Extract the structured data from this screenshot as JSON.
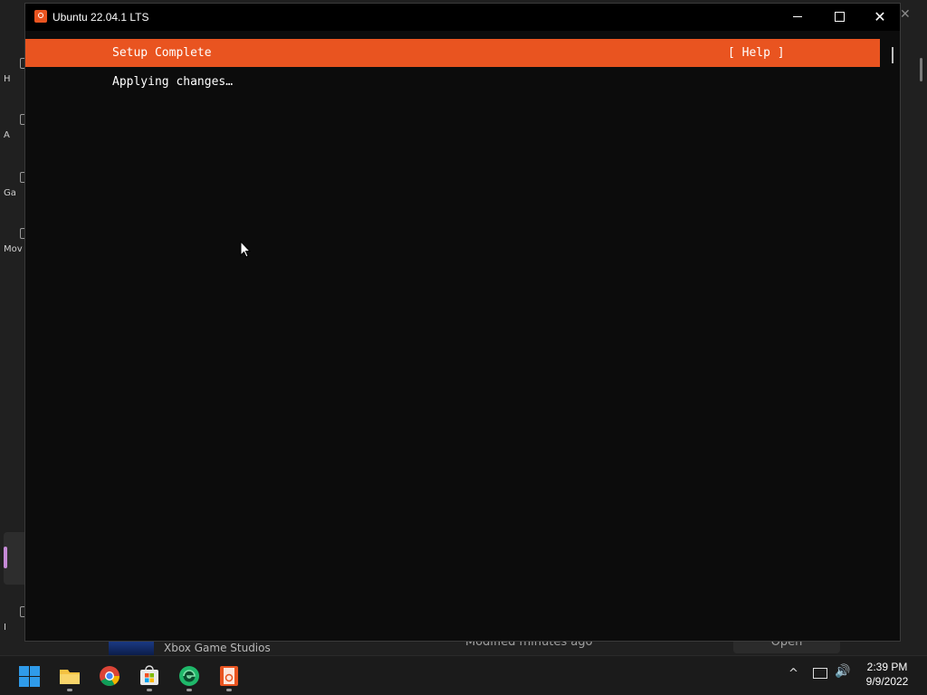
{
  "window": {
    "title": "Ubuntu 22.04.1 LTS",
    "close_glyph": "✕"
  },
  "installer": {
    "header_title": "Setup Complete",
    "help_label": "[ Help ]",
    "status_text": "Applying changes…",
    "accent_color": "#e95420"
  },
  "background_app": {
    "nav_labels": [
      "H",
      "A",
      "Ga",
      "Mov",
      "I"
    ],
    "row": {
      "publisher": "Xbox Game Studios",
      "modified": "Modified minutes ago",
      "action": "Open",
      "more": "⋯"
    },
    "close_glyph": "✕"
  },
  "taskbar": {
    "apps": [
      "start",
      "file-explorer",
      "chrome",
      "microsoft-store",
      "edge-dev",
      "ubuntu"
    ],
    "tray_chevron": "^",
    "sound_glyph": "🔊",
    "time": "2:39 PM",
    "date": "9/9/2022"
  }
}
